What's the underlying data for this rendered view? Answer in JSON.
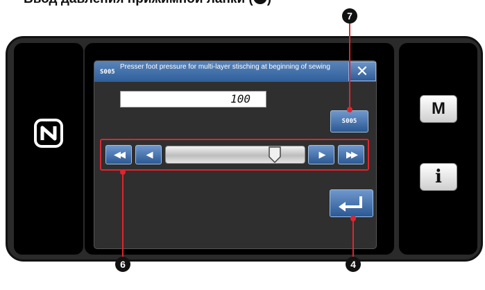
{
  "heading": "Ввод давления прижимной лапки (",
  "heading_tail": ")",
  "dialog": {
    "code": "S005",
    "title": "Presser foot pressure for multi-layer stisching at beginning of sewing",
    "close_symbol": "✕",
    "value": "100",
    "param_button_label": "S005"
  },
  "slider": {
    "fast_left": "◀◀",
    "step_left": "◀",
    "step_right": "▶",
    "fast_right": "▶▶",
    "level": 0.82
  },
  "side_buttons": {
    "mode_label": "M",
    "info_label": "i"
  },
  "callouts": {
    "slider_group": "6",
    "param_button": "7",
    "enter_button": "4"
  },
  "icons": {
    "nfc": "nfc-icon",
    "enter": "enter-return-icon"
  },
  "colors": {
    "accent_button": "#2f5f9c",
    "callout_line": "#e0242f"
  }
}
